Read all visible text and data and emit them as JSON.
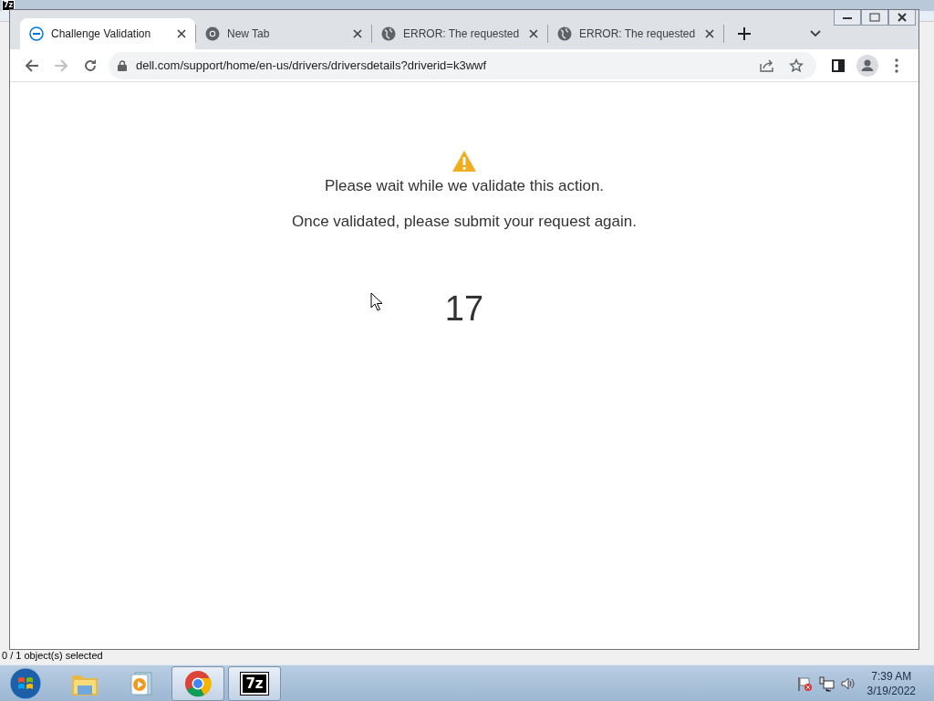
{
  "background_window": {
    "icon_label": "7z",
    "status_text": "0 / 1 object(s) selected"
  },
  "browser": {
    "tabs": [
      {
        "title": "Challenge Validation",
        "kind": "site",
        "selected": true
      },
      {
        "title": "New Tab",
        "kind": "newtab",
        "selected": false
      },
      {
        "title": "ERROR: The requested",
        "kind": "error",
        "selected": false
      },
      {
        "title": "ERROR: The requested",
        "kind": "error",
        "selected": false
      }
    ],
    "address": "dell.com/support/home/en-us/drivers/driversdetails?driverid=k3wwf"
  },
  "page": {
    "message": "Please wait while we validate this action.",
    "instruction": "Once validated, please submit your request again.",
    "countdown": "17"
  },
  "taskbar": {
    "apps": [
      {
        "kind": "explorer",
        "active": false
      },
      {
        "kind": "player",
        "active": false
      },
      {
        "kind": "chrome",
        "active": true
      },
      {
        "kind": "sevenzip",
        "label": "7z",
        "active": true
      }
    ],
    "clock": {
      "time": "7:39 AM",
      "date": "3/19/2022"
    }
  }
}
